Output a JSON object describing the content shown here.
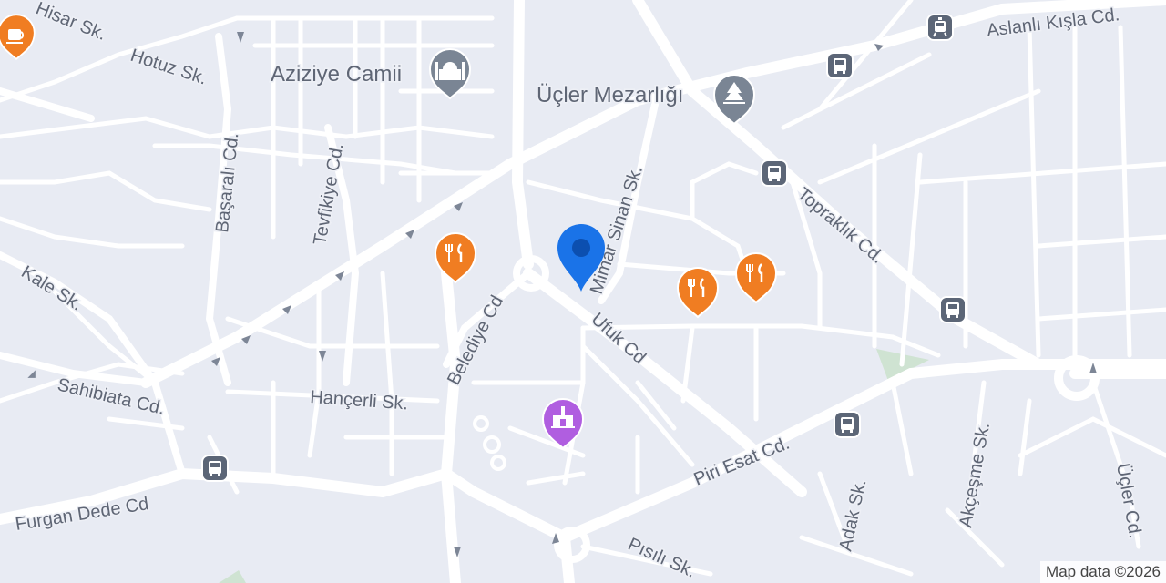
{
  "map": {
    "streets": {
      "hisar": "Hisar Sk.",
      "hotuz": "Hotuz Sk.",
      "basarali": "Başaralı Cd.",
      "tevfikiye": "Tevfikiye Cd.",
      "kale": "Kale Sk.",
      "sahibiata": "Sahibiata Cd.",
      "hancerli": "Hançerli Sk.",
      "belediye": "Belediye Cd",
      "mimar_sinan": "Mimar Sinan Sk.",
      "ufuk": "Ufuk Cd",
      "topraklik": "Topraklık Cd.",
      "aslanli_kisla": "Aslanlı Kışla Cd.",
      "piri_esat": "Piri Esat Cd.",
      "adak": "Adak Sk.",
      "akcesme": "Akçeşme Sk.",
      "ucler": "Üçler Cd.",
      "furgan_dede": "Furgan Dede Cd",
      "pisili": "Pısılı Sk."
    },
    "places": {
      "aziziye_camii": "Aziziye Camii",
      "ucler_mezarligi": "Üçler Mezarlığı"
    },
    "icons": {
      "cafe": "cafe-icon",
      "mosque": "mosque-icon",
      "cemetery": "cemetery-icon",
      "restaurant": "restaurant-icon",
      "museum": "museum-icon",
      "bus": "bus-icon",
      "tram": "tram-icon",
      "location_pin": "location-pin-icon"
    },
    "colors": {
      "background": "#e8ebf3",
      "road": "#ffffff",
      "restaurant": "#f07d22",
      "museum": "#b05ee0",
      "landmark": "#7a8594",
      "transit": "#5c6677",
      "pin": "#1a73e8",
      "park": "#cfe3d2"
    }
  },
  "attribution": "Map data ©2026"
}
